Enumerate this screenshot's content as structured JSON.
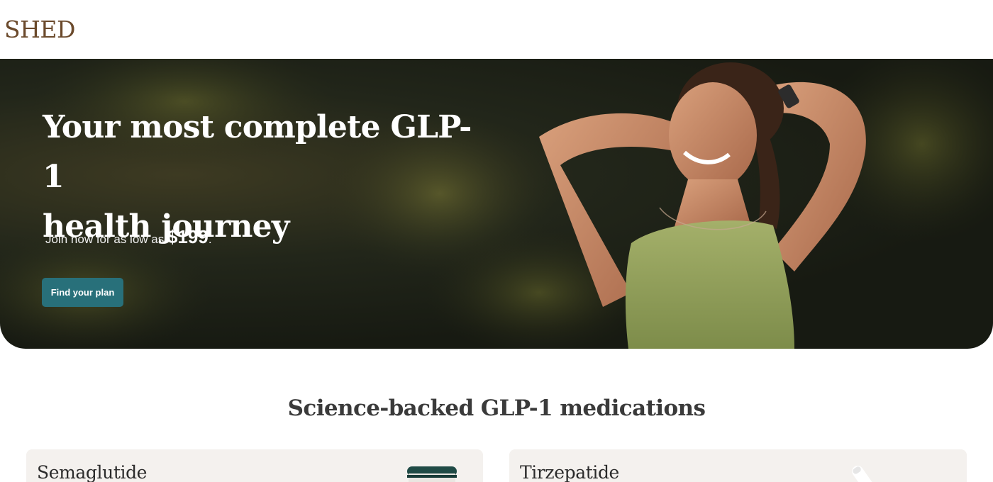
{
  "brand": {
    "logo": "SHED"
  },
  "hero": {
    "title_line1": "Your most complete GLP-1",
    "title_line2": "health journey",
    "subtitle_prefix": "Join now for as low as ",
    "price": "$199",
    "subtitle_suffix": ".",
    "cta_label": "Find your plan"
  },
  "medications": {
    "heading": "Science-backed GLP-1 medications",
    "cards": [
      {
        "name": "Semaglutide",
        "image_icon": "medication-jar-icon"
      },
      {
        "name": "Tirzepatide",
        "image_icon": "injection-pen-icon"
      }
    ]
  },
  "colors": {
    "logo": "#6b4a2c",
    "cta": "#28707a",
    "card_bg": "#f4f1ee",
    "hero_top": "#8fa15a"
  }
}
